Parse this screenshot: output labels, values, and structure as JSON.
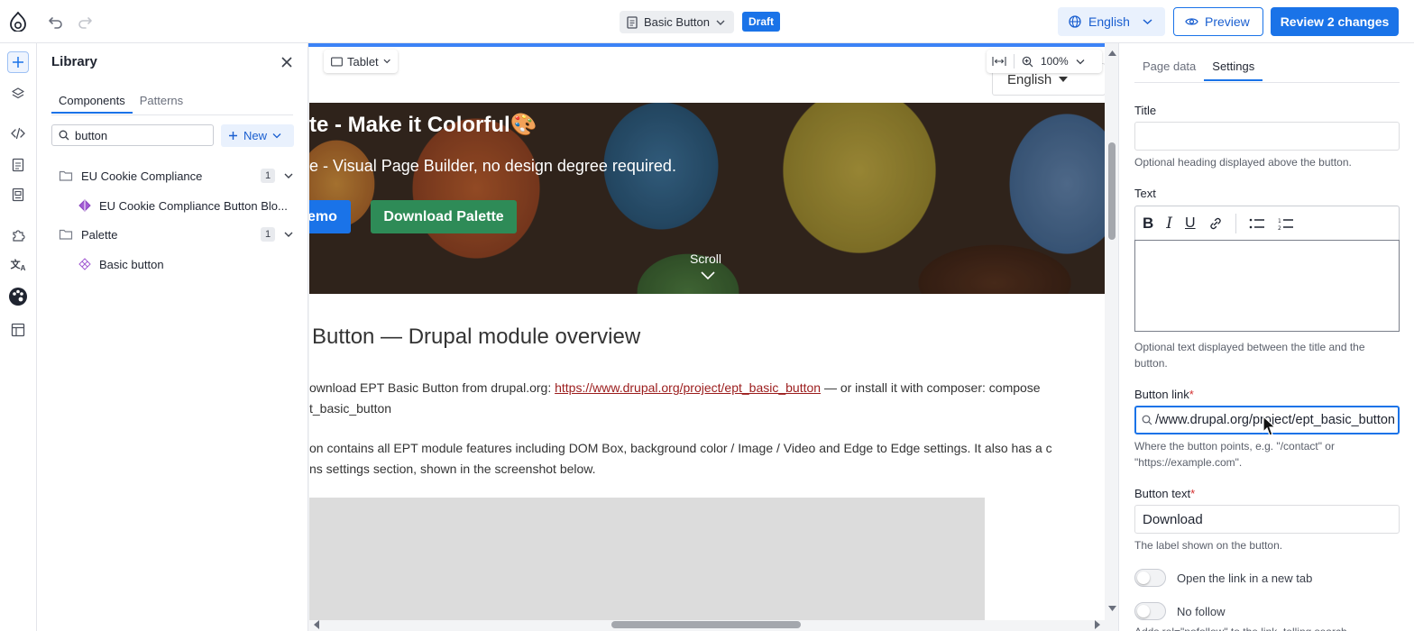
{
  "topbar": {
    "page_title": "Basic Button",
    "status_badge": "Draft",
    "language": "English",
    "preview_label": "Preview",
    "review_label": "Review 2 changes",
    "accent_color": "#1a73e8"
  },
  "rail": {
    "icons": [
      "add-icon",
      "layers-icon",
      "code-icon",
      "page-icon",
      "template-icon",
      "extension-icon",
      "translate-icon",
      "palette-icon",
      "layout-icon"
    ]
  },
  "library": {
    "title": "Library",
    "tabs": [
      "Components",
      "Patterns"
    ],
    "active_tab": "Components",
    "search_value": "button",
    "new_label": "New",
    "groups": [
      {
        "label": "EU Cookie Compliance",
        "count": "1",
        "items": [
          "EU Cookie Compliance Button Blo..."
        ]
      },
      {
        "label": "Palette",
        "count": "1",
        "items": [
          "Basic button"
        ]
      }
    ]
  },
  "canvas": {
    "device": "Tablet",
    "zoom": "100%",
    "site_language": "English",
    "hero_title": "te - Make it Colorful🎨",
    "hero_subtitle": "e - Visual Page Builder, no design degree required.",
    "demo_button": "emo",
    "download_button": "Download Palette",
    "scroll_label": "Scroll",
    "article_heading": "Button — Drupal module overview",
    "para1_line1_pre": "ownload EPT Basic Button from drupal.org: ",
    "para1_link": "https://www.drupal.org/project/ept_basic_button",
    "para1_line1_post": " — or install it with composer: compose",
    "para1_line2": "t_basic_button",
    "para2_line1": "on contains all EPT module features including DOM Box, background color / Image / Video and Edge to Edge settings. It also has a c",
    "para2_line2": "ns settings section, shown in the screenshot below."
  },
  "settings": {
    "tabs": [
      "Page data",
      "Settings"
    ],
    "active_tab": "Settings",
    "title_label": "Title",
    "title_value": "",
    "title_help": "Optional heading displayed above the button.",
    "text_label": "Text",
    "text_help": "Optional text displayed between the title and the button.",
    "link_label": "Button link",
    "link_value": "/www.drupal.org/project/ept_basic_button",
    "link_help": "Where the button points, e.g. \"/contact\" or \"https://example.com\".",
    "btn_text_label": "Button text",
    "btn_text_value": "Download",
    "btn_text_help": "The label shown on the button.",
    "toggle_new_tab": "Open the link in a new tab",
    "toggle_nofollow": "No follow",
    "nofollow_help": "Adds rel=\"nofollow\" to the link, telling search"
  }
}
